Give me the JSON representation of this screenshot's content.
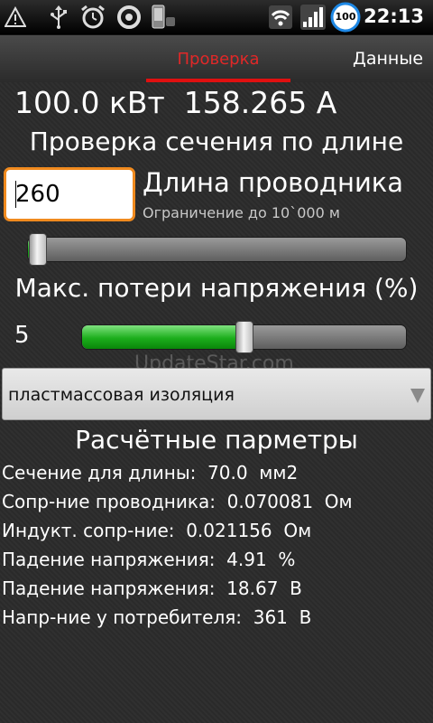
{
  "status_bar": {
    "time": "22:13",
    "battery_level": "100",
    "icons": [
      "warning-icon",
      "usb-icon",
      "alarm-icon",
      "sync-icon",
      "phone-icon",
      "wifi-icon",
      "signal-icon",
      "battery-icon"
    ]
  },
  "tabs": [
    {
      "label": "Проверка",
      "selected": true
    },
    {
      "label": "Данные",
      "selected": false
    }
  ],
  "summary": {
    "power": "100.0 кВт",
    "current": "158.265 А"
  },
  "section_title": "Проверка сечения по длине",
  "length": {
    "input_value": "260",
    "label": "Длина проводника",
    "hint": "Ограничение до 10`000 м",
    "slider_fraction": 0.026
  },
  "voltage_loss": {
    "label": "Макс. потери напряжения (%)",
    "value": "5",
    "slider_fraction": 0.5
  },
  "watermark": "UpdateStar.com",
  "insulation": {
    "selected": "пластмассовая изоляция"
  },
  "results": {
    "title": "Расчётные парметры",
    "rows": [
      "Сечение для длины:  70.0  мм2",
      "Сопр-ние проводника:  0.070081  Ом",
      "Индукт. сопр-ние:  0.021156  Ом",
      "Падение напряжения:  4.91  %",
      "Падение напряжения:  18.67  В",
      "Напр-ние у потребителя:  361  В"
    ]
  },
  "colors": {
    "accent_orange": "#f08a1e",
    "tab_red": "#e02828",
    "slider_green": "#1cae1c",
    "battery_blue": "#1e88e5"
  }
}
